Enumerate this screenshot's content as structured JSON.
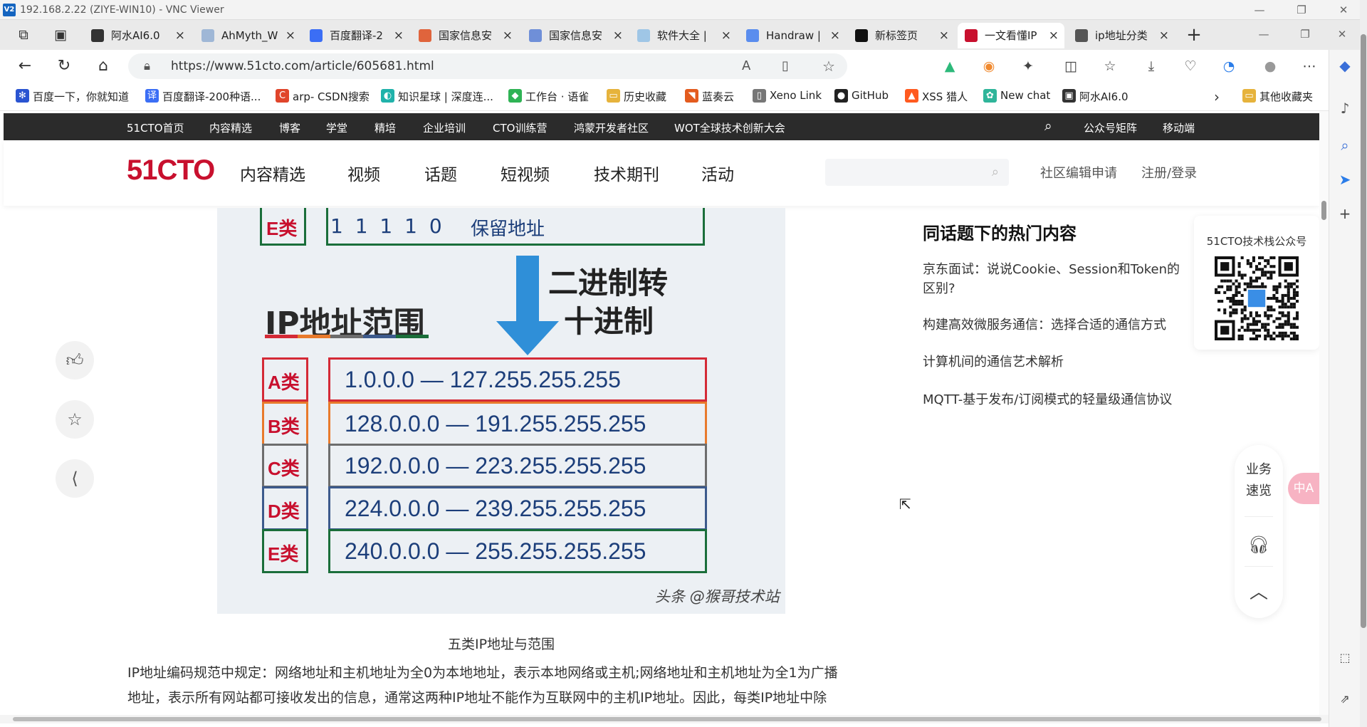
{
  "vnc": {
    "logo": "V2",
    "title": "192.168.2.22 (ZIYE-WIN10) - VNC Viewer"
  },
  "tabs": [
    {
      "label": "阿水AI6.0",
      "close": "×",
      "color": "#333333"
    },
    {
      "label": "AhMyth_W",
      "close": "×",
      "color": "#9fb7d6"
    },
    {
      "label": "百度翻译-2",
      "close": "×",
      "color": "#3b6ef5"
    },
    {
      "label": "国家信息安",
      "close": "×",
      "color": "#e0643c"
    },
    {
      "label": "国家信息安",
      "close": "×",
      "color": "#6f8fd8"
    },
    {
      "label": "软件大全 |",
      "close": "×",
      "color": "#9fc6e6"
    },
    {
      "label": "Handraw |",
      "close": "×",
      "color": "#5a8dee"
    },
    {
      "label": "新标签页",
      "close": "×",
      "color": "#111111"
    },
    {
      "label": "一文看懂IP",
      "close": "×",
      "color": "#c8102e"
    },
    {
      "label": "ip地址分类",
      "close": "×",
      "color": "#555555"
    }
  ],
  "new_tab": "+",
  "url": "https://www.51cto.com/article/605681.html",
  "bookmarks": [
    {
      "label": "百度一下，你就知道",
      "color": "#2a54d1",
      "glyph": "✻"
    },
    {
      "label": "百度翻译-200种语...",
      "color": "#3b6ef5",
      "glyph": "译"
    },
    {
      "label": "arp- CSDN搜索",
      "color": "#e0452b",
      "glyph": "C"
    },
    {
      "label": "知识星球 | 深度连...",
      "color": "#20b2aa",
      "glyph": "◐"
    },
    {
      "label": "工作台 · 语雀",
      "color": "#2fb355",
      "glyph": "◆"
    },
    {
      "label": "历史收藏",
      "color": "#e6b33c",
      "glyph": "▭"
    },
    {
      "label": "蓝奏云",
      "color": "#e35b1e",
      "glyph": "◥"
    },
    {
      "label": "Xeno Link",
      "color": "#777777",
      "glyph": "▯"
    },
    {
      "label": "GitHub",
      "color": "#222222",
      "glyph": "●"
    },
    {
      "label": "XSS 猎人",
      "color": "#ff5a1f",
      "glyph": "▲"
    },
    {
      "label": "New chat",
      "color": "#2fb59a",
      "glyph": "✿"
    },
    {
      "label": "阿水AI6.0",
      "color": "#333333",
      "glyph": "▣"
    }
  ],
  "bookmarks_more": "其他收藏夹",
  "site": {
    "topnav": [
      "51CTO首页",
      "内容精选",
      "博客",
      "学堂",
      "精培",
      "企业培训",
      "CTO训练营",
      "鸿蒙开发者社区",
      "WOT全球技术创新大会"
    ],
    "topnav_right": [
      "公众号矩阵",
      "移动端"
    ],
    "logo": "51CTO",
    "mainnav": [
      "内容精选",
      "视频",
      "话题",
      "短视频",
      "技术期刊",
      "活动"
    ],
    "mainnav_right": [
      "社区编辑申请",
      "注册/登录"
    ]
  },
  "figure": {
    "top_row_label": "E类",
    "top_row_bits": "1 1 1 1 0",
    "top_row_text": "保留地址",
    "convert_line1": "二进制转",
    "convert_line2": "十进制",
    "ip_label": "IP地址范围",
    "rows": [
      {
        "cls": "A类",
        "range": "1.0.0.0 — 127.255.255.255",
        "color": "#d42a36"
      },
      {
        "cls": "B类",
        "range": "128.0.0.0 — 191.255.255.255",
        "color": "#e87a2c"
      },
      {
        "cls": "C类",
        "range": "192.0.0.0 — 223.255.255.255",
        "color": "#6d6d6d"
      },
      {
        "cls": "D类",
        "range": "224.0.0.0 — 239.255.255.255",
        "color": "#3c5a8c"
      },
      {
        "cls": "E类",
        "range": "240.0.0.0 — 255.255.255.255",
        "color": "#1a6e3a"
      }
    ],
    "watermark": "头条 @猴哥技术站"
  },
  "caption": "五类IP地址与范围",
  "paragraph": [
    "IP地址编码规范中规定：网络地址和主机地址为全0为本地地址，表示本地网络或主机;网络地址和主机地址为全1为广播",
    "地址，表示所有网站都可接收发出的信息，通常这两种IP地址不能作为互联网中的主机IP地址。因此，每类IP地址中除"
  ],
  "hot": {
    "title": "同话题下的热门内容",
    "items": [
      "京东面试：说说Cookie、Session和Token的区别?",
      "构建高效微服务通信：选择合适的通信方式",
      "计算机间的通信艺术解析",
      "MQTT-基于发布/订阅模式的轻量级通信协议"
    ]
  },
  "qr_title": "51CTO技术栈公众号",
  "side_tools": {
    "biz_line1": "业务",
    "biz_line2": "速览",
    "lang": "中A"
  }
}
